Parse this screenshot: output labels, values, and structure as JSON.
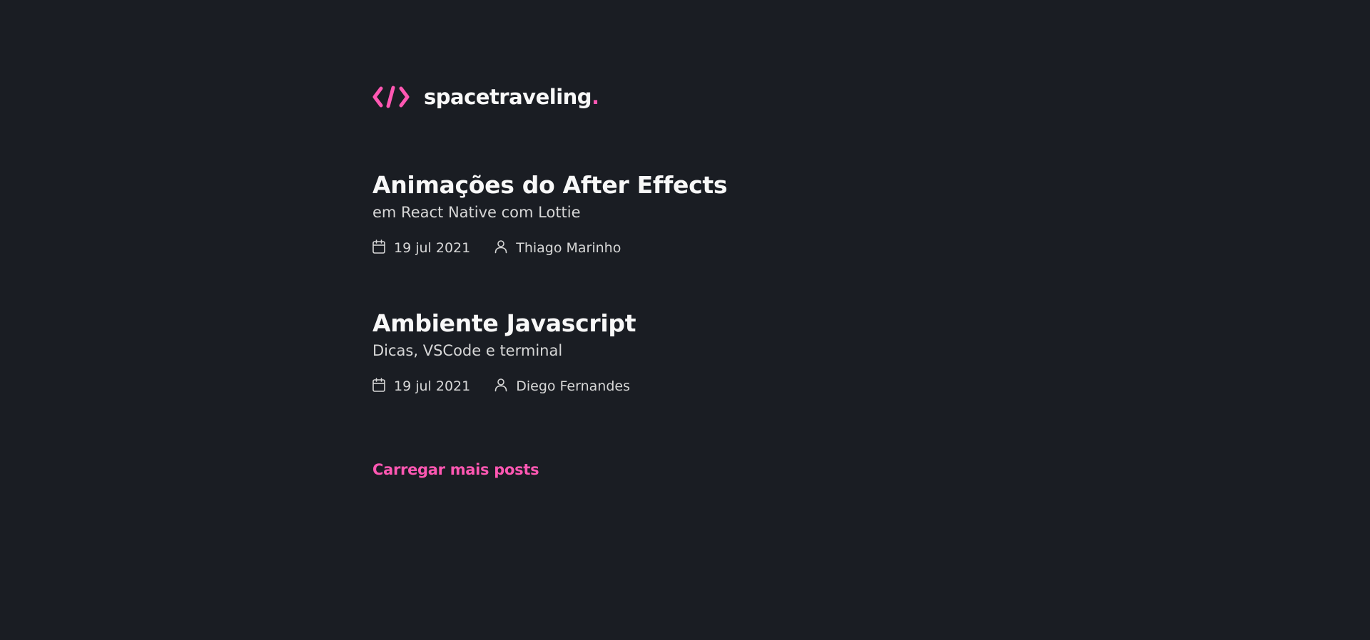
{
  "header": {
    "logo_icon": "code-brackets-icon",
    "logo_text": "spacetraveling",
    "logo_dot": ".",
    "accent_color": "#ff57b2"
  },
  "posts": [
    {
      "title": "Animações do After Effects",
      "subtitle": "em React Native com Lottie",
      "date": "19 jul 2021",
      "author": "Thiago Marinho",
      "date_icon": "calendar-icon",
      "author_icon": "user-icon"
    },
    {
      "title": "Ambiente Javascript",
      "subtitle": "Dicas, VSCode e terminal",
      "date": "19 jul 2021",
      "author": "Diego Fernandes",
      "date_icon": "calendar-icon",
      "author_icon": "user-icon"
    }
  ],
  "load_more_label": "Carregar mais posts",
  "colors": {
    "background": "#1a1d23",
    "heading": "#f8f8f8",
    "body_text": "#d7d7d7",
    "accent": "#ff57b2"
  }
}
